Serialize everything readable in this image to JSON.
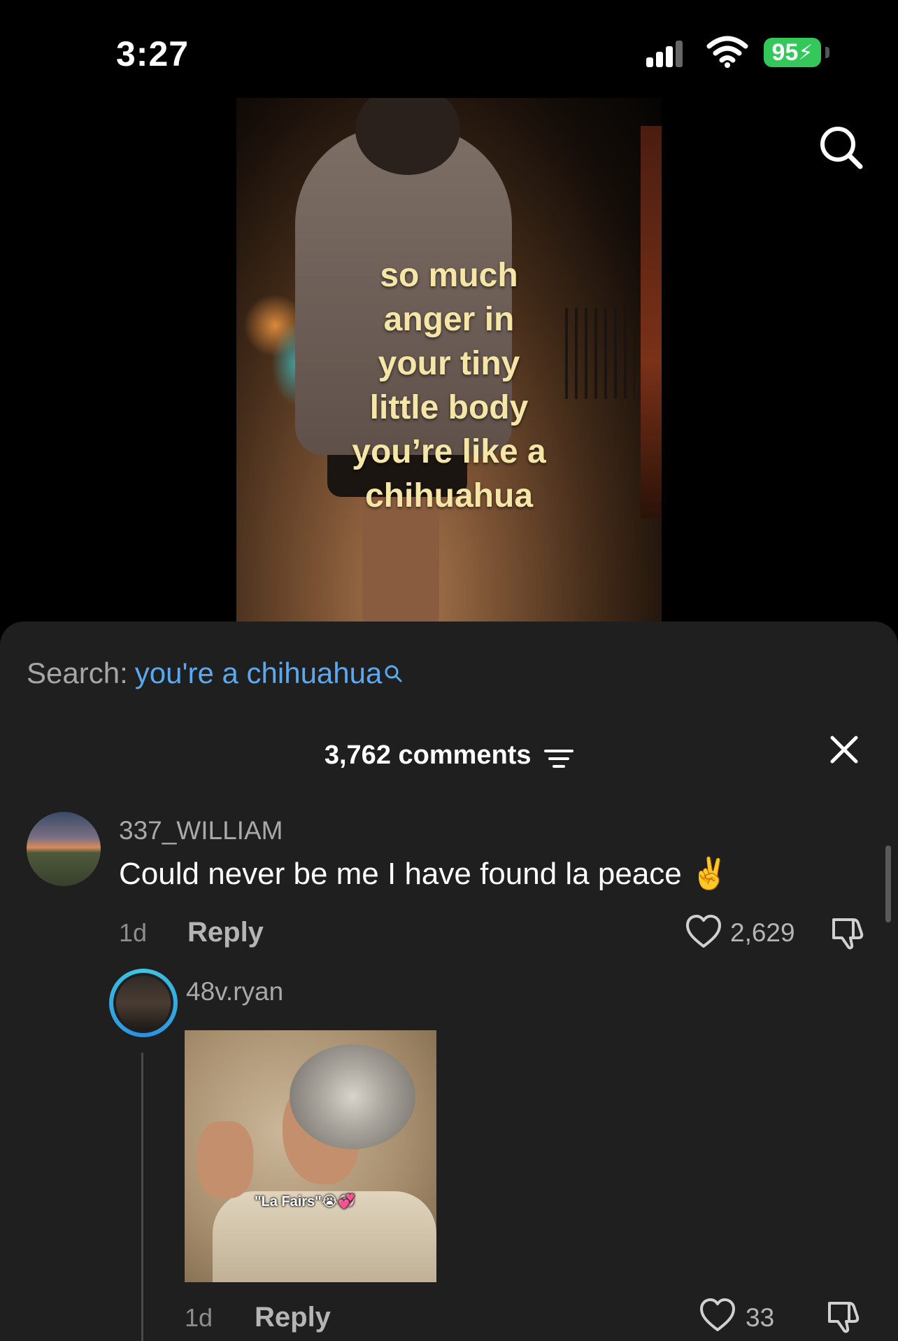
{
  "status_bar": {
    "time": "3:27",
    "battery": "95"
  },
  "video": {
    "overlay_text": "so much\nanger in\nyour tiny\nlittle body\nyou’re like a\nchihuahua"
  },
  "search": {
    "label": "Search:",
    "term": "you're a chihuahua"
  },
  "comments": {
    "count_label": "3,762 comments",
    "items": [
      {
        "username": "337_WILLIAM",
        "text": "Could never be me I have found la peace ✌️",
        "time": "1d",
        "reply_label": "Reply",
        "likes": "2,629"
      },
      {
        "username": "48v.ryan",
        "image_caption": "\"La Fairs\"😭💞",
        "time": "1d",
        "reply_label": "Reply",
        "likes": "33"
      }
    ]
  },
  "icons": {
    "search": "search-icon",
    "close": "close-icon",
    "filter": "filter-icon",
    "like": "heart-icon",
    "dislike": "dislike-icon"
  },
  "colors": {
    "accent_link": "#5aa9f0",
    "battery": "#34c759",
    "sheet_bg": "#1f1f1f"
  }
}
